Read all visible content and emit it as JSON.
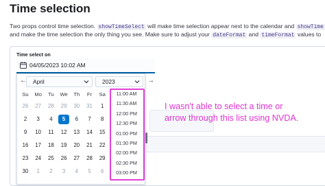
{
  "page": {
    "title": "Time selection",
    "description_line1": {
      "a": "Two props control time selection.",
      "code1": "showTimeSelect",
      "b": "will make time selection appear next to the calendar and",
      "code2": "showTime"
    },
    "description_line2": {
      "a": "and make the time selection the only thing you see. Make sure to adjust your",
      "code1": "dateFormat",
      "b": "and",
      "code2": "timeFormat",
      "c": "values to"
    }
  },
  "field": {
    "label": "Time select on",
    "value": "04/05/2023 10:02 AM",
    "icon": "calendar-icon"
  },
  "calendar": {
    "prev_glyph": "←",
    "next_glyph": "→",
    "month": "April",
    "year": "2023",
    "weekdays": [
      "Su",
      "Mo",
      "Tu",
      "We",
      "Th",
      "Fr",
      "Sa"
    ],
    "days": [
      "26",
      "27",
      "28",
      "29",
      "30",
      "31",
      "1",
      "2",
      "3",
      "4",
      "5",
      "6",
      "7",
      "8",
      "9",
      "10",
      "11",
      "12",
      "13",
      "14",
      "15",
      "16",
      "17",
      "18",
      "19",
      "20",
      "21",
      "22",
      "23",
      "24",
      "25",
      "26",
      "27",
      "28",
      "29",
      "30",
      "1",
      "2",
      "3",
      "4",
      "5",
      "6"
    ],
    "selected_day": "5",
    "selected_color": "#0077cc"
  },
  "time_list": {
    "items": [
      "11:00 AM",
      "11:30 AM",
      "12:00 PM",
      "12:30 PM",
      "01:00 PM",
      "01:30 PM",
      "02:00 PM",
      "02:30 PM",
      "03:00 PM"
    ]
  },
  "annotation": {
    "line1": "I wasn't able to select a time or",
    "line2": "arrow through this list using NVDA.",
    "color": "#de34d0"
  }
}
